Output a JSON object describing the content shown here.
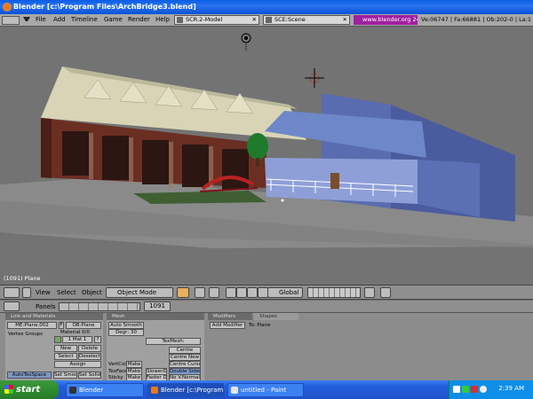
{
  "window": {
    "title": "Blender [c:\\Program Files\\ArchBridge3.blend]"
  },
  "menu": [
    "File",
    "Add",
    "Timeline",
    "Game",
    "Render",
    "Help"
  ],
  "screens": [
    {
      "label": "SCR:2-Model"
    },
    {
      "label": "SCE:Scene"
    }
  ],
  "url": "www.blender.org 241",
  "stats": "Ve:06747 | Fa:66881 | Ob:202-0 | La:1",
  "viewport": {
    "label": "(1091) Plane"
  },
  "vp_header": {
    "view": "View",
    "select": "Select",
    "object": "Object",
    "mode": "Object Mode",
    "orientation": "Global"
  },
  "btn_header": {
    "panels": "Panels",
    "frame": "1091"
  },
  "link_materials": {
    "tab": "Link and Materials",
    "me": "ME:Plane.002",
    "f": "F",
    "ob": "OB:Plane",
    "vertex_groups": "Vertex Groups",
    "material": "Material 0/0",
    "mat_index": "1 Mat 1",
    "q": "?",
    "new": "New",
    "delete": "Delete",
    "select": "Select",
    "deselect": "Deselect",
    "assign": "Assign",
    "autotex": "AutoTexSpace",
    "set_smooth": "Set Smoot",
    "set_solid": "Set Solid"
  },
  "mesh": {
    "tab": "Mesh",
    "auto_smooth": "Auto Smooth",
    "degr": "Degr: 30",
    "sticky_label": "Sticky",
    "vertcol": "VertCol",
    "texface": "TexFace",
    "sticky": "Sticky",
    "make": "Make",
    "texmesh": "TexMesh:",
    "centre": "Centre",
    "centre_new": "Centre New",
    "centre_cursor": "Centre Cursor",
    "slower": "SlowerD",
    "double_sided": "Double Sided",
    "fastera": "Faster D",
    "no_vnormal": "No V.Normal"
  },
  "modifiers": {
    "tab": "Modifiers",
    "tab2": "Shapes",
    "add_modifier": "Add Modifier",
    "to": "To: Plane"
  },
  "taskbar": {
    "start": "start",
    "tasks": [
      {
        "label": "Blender"
      },
      {
        "label": "Blender [c:\\Program ..."
      },
      {
        "label": "untitled - Paint"
      }
    ],
    "clock": "2:39 AM"
  },
  "colors": {
    "titlebar": "#0a5de5",
    "start": "#2e8b2e",
    "url_bg": "#a020a0",
    "viewport_bg": "#737373"
  }
}
